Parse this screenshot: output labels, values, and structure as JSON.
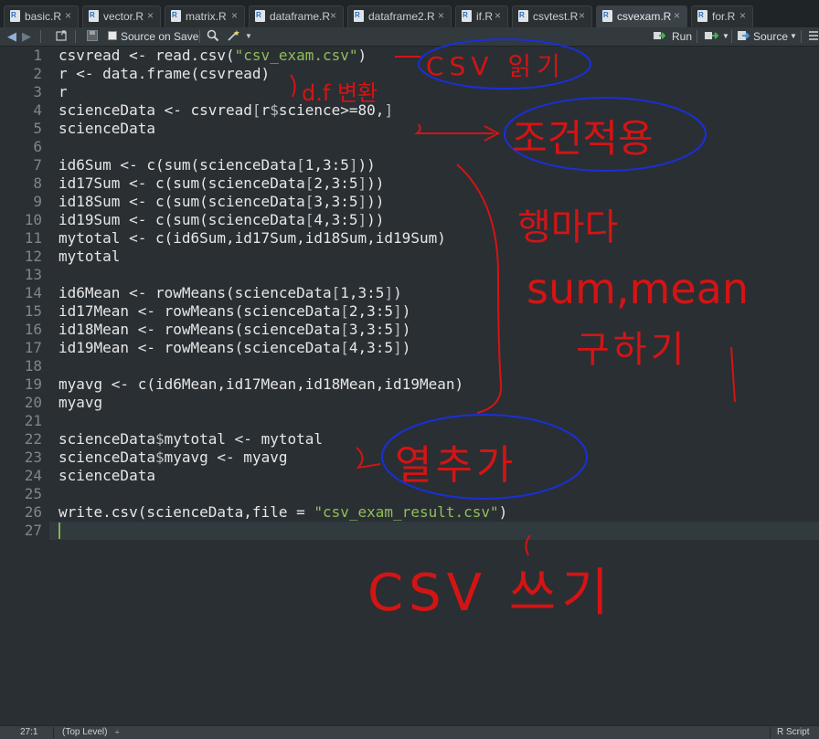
{
  "tabs": [
    "basic.R",
    "vector.R",
    "matrix.R",
    "dataframe.R",
    "dataframe2.R",
    "if.R",
    "csvtest.R",
    "csvexam.R",
    "for.R"
  ],
  "toolbar": {
    "source_on_save": "Source on Save",
    "run": "Run",
    "source": "Source"
  },
  "code": [
    "csvread <- read.csv(\"csv_exam.csv\")",
    "r <- data.frame(csvread)",
    "r",
    "scienceData <- csvread[r$science>=80,]",
    "scienceData",
    "",
    "id6Sum <- c(sum(scienceData[1,3:5]))",
    "id17Sum <- c(sum(scienceData[2,3:5]))",
    "id18Sum <- c(sum(scienceData[3,3:5]))",
    "id19Sum <- c(sum(scienceData[4,3:5]))",
    "mytotal <- c(id6Sum,id17Sum,id18Sum,id19Sum)",
    "mytotal",
    "",
    "id6Mean <- rowMeans(scienceData[1,3:5])",
    "id17Mean <- rowMeans(scienceData[2,3:5])",
    "id18Mean <- rowMeans(scienceData[3,3:5])",
    "id19Mean <- rowMeans(scienceData[4,3:5])",
    "",
    "myavg <- c(id6Mean,id17Mean,id18Mean,id19Mean)",
    "myavg",
    "",
    "scienceData$mytotal <- mytotal",
    "scienceData$myavg <- myavg",
    "scienceData",
    "",
    "write.csv(scienceData,file = \"csv_exam_result.csv\")",
    ""
  ],
  "annotations": {
    "csv_read": "CSV 읽기",
    "df_convert": "d.f 변환",
    "condition": "조건적용",
    "per_row": "행마다",
    "sum_mean": "sum,mean",
    "compute": "구하기",
    "add_col": "열추가",
    "csv_write": "CSV 쓰기"
  },
  "status": {
    "position": "27:1",
    "scope": "(Top Level)",
    "filetype": "R Script"
  },
  "colors": {
    "annotation_red": "#d41414",
    "annotation_blue": "#1a2fd8",
    "string_color": "#8fbf5a",
    "bracket_color": "#b8bec2"
  }
}
